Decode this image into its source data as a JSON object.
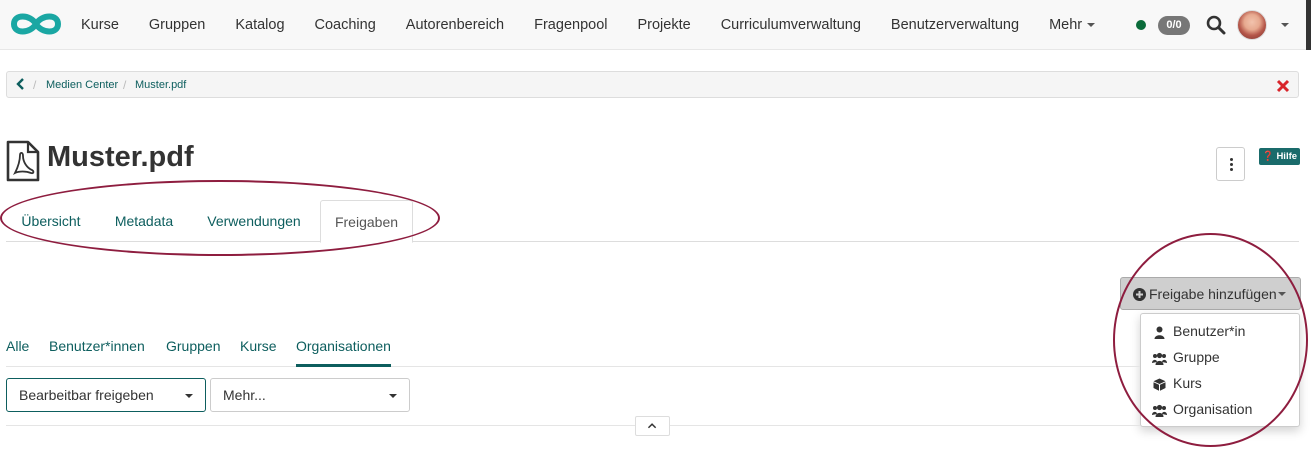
{
  "navbar": {
    "items": [
      "Kurse",
      "Gruppen",
      "Katalog",
      "Coaching",
      "Autorenbereich",
      "Fragenpool",
      "Projekte",
      "Curriculumverwaltung",
      "Benutzerverwaltung",
      "Mehr"
    ],
    "count_badge": "0/0",
    "status_color": "#0a6b3a",
    "logo_icon": "openolat-infinity-logo",
    "search_icon": "search-icon"
  },
  "breadcrumb": {
    "items": [
      "Medien Center",
      "Muster.pdf"
    ],
    "back_icon": "chevron-left-icon",
    "close_icon": "close-icon"
  },
  "page": {
    "title": "Muster.pdf",
    "file_icon": "pdf-file-icon",
    "help_label": "Hilfe"
  },
  "tabs": [
    {
      "label": "Übersicht",
      "active": false
    },
    {
      "label": "Metadata",
      "active": false
    },
    {
      "label": "Verwendungen",
      "active": false
    },
    {
      "label": "Freigaben",
      "active": true
    }
  ],
  "share": {
    "add_button_label": "Freigabe hinzufügen",
    "menu": [
      {
        "label": "Benutzer*in",
        "icon": "user-icon"
      },
      {
        "label": "Gruppe",
        "icon": "group-icon"
      },
      {
        "label": "Kurs",
        "icon": "cube-icon"
      },
      {
        "label": "Organisation",
        "icon": "group-icon"
      }
    ]
  },
  "subtabs": [
    {
      "label": "Alle",
      "active": false
    },
    {
      "label": "Benutzer*innen",
      "active": false
    },
    {
      "label": "Gruppen",
      "active": false
    },
    {
      "label": "Kurse",
      "active": false
    },
    {
      "label": "Organisationen",
      "active": true
    }
  ],
  "filters": {
    "primary_select": "Bearbeitbar freigeben",
    "secondary_select": "Mehr..."
  },
  "colors": {
    "accent": "#0d5e5e",
    "highlight": "#8e1d3f",
    "close": "#d9252b",
    "logo": "#1aa7a3"
  }
}
